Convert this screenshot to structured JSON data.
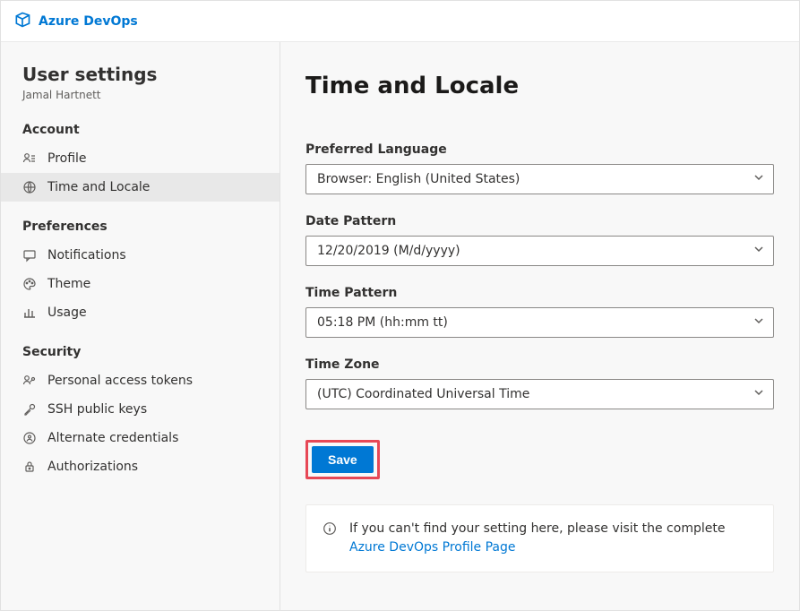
{
  "header": {
    "brand": "Azure DevOps"
  },
  "sidebar": {
    "title": "User settings",
    "subtitle": "Jamal Hartnett",
    "sections": [
      {
        "label": "Account",
        "items": [
          {
            "label": "Profile"
          },
          {
            "label": "Time and Locale",
            "active": true
          }
        ]
      },
      {
        "label": "Preferences",
        "items": [
          {
            "label": "Notifications"
          },
          {
            "label": "Theme"
          },
          {
            "label": "Usage"
          }
        ]
      },
      {
        "label": "Security",
        "items": [
          {
            "label": "Personal access tokens"
          },
          {
            "label": "SSH public keys"
          },
          {
            "label": "Alternate credentials"
          },
          {
            "label": "Authorizations"
          }
        ]
      }
    ]
  },
  "main": {
    "title": "Time and Locale",
    "fields": {
      "language": {
        "label": "Preferred Language",
        "value": "Browser: English (United States)"
      },
      "datePattern": {
        "label": "Date Pattern",
        "value": "12/20/2019 (M/d/yyyy)"
      },
      "timePattern": {
        "label": "Time Pattern",
        "value": "05:18 PM (hh:mm tt)"
      },
      "timeZone": {
        "label": "Time Zone",
        "value": "(UTC) Coordinated Universal Time"
      }
    },
    "saveLabel": "Save",
    "info": {
      "prefix": "If you can't find your setting here, please visit the complete ",
      "linkText": "Azure DevOps Profile Page"
    }
  }
}
